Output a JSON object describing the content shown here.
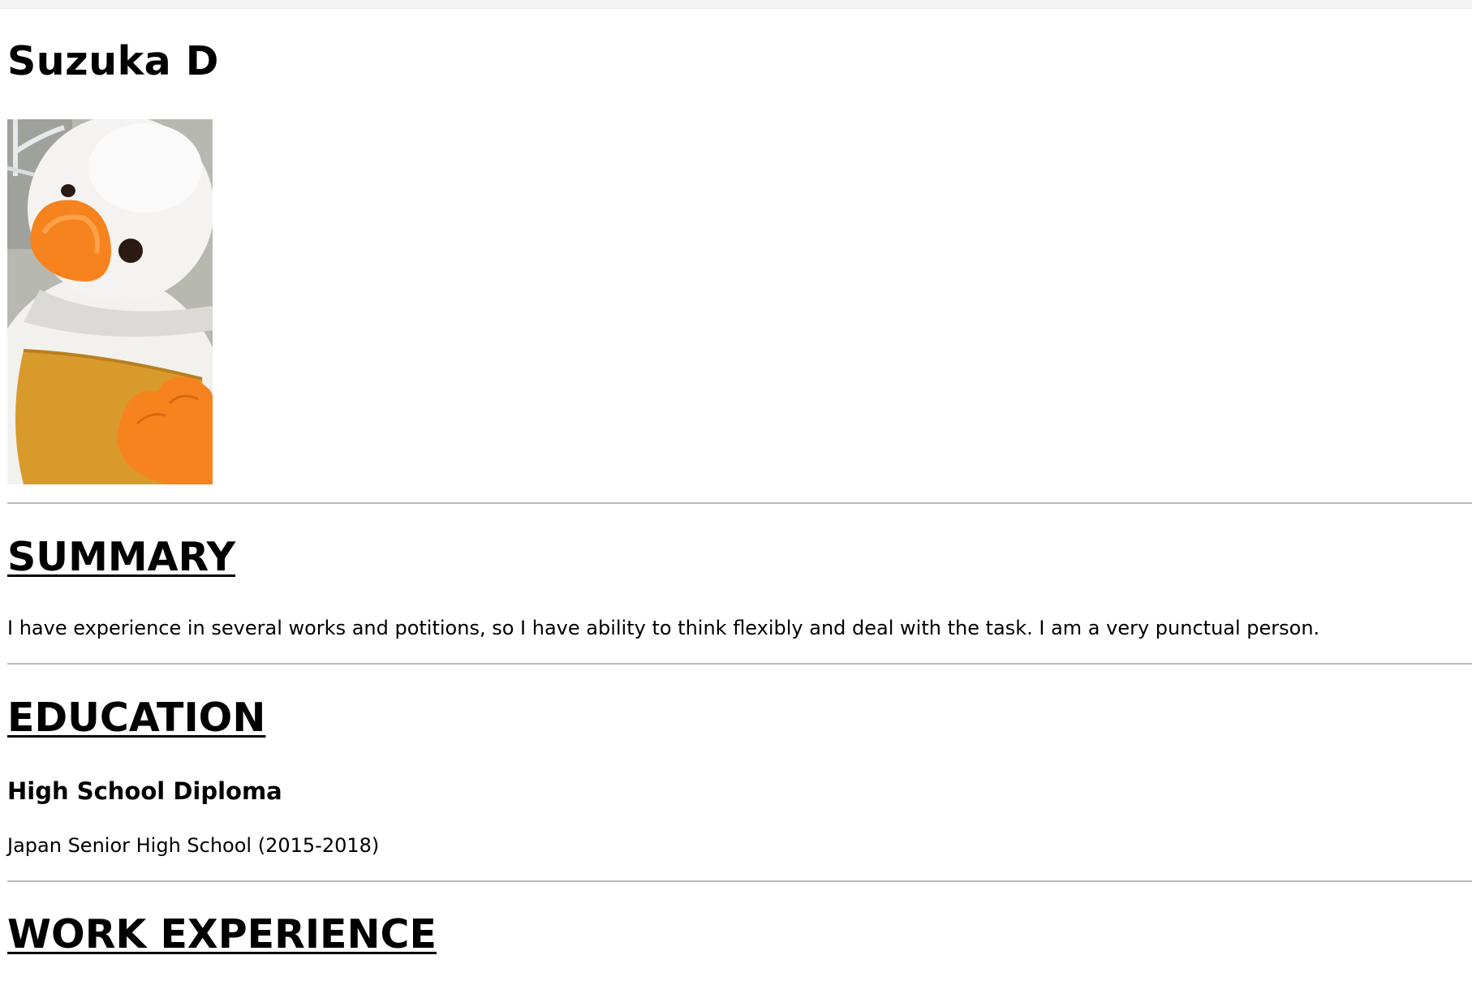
{
  "profile": {
    "name": "Suzuka D",
    "photo_icon": "plush-duck-photo"
  },
  "summary": {
    "heading": "SUMMARY",
    "text": "I have experience in several works and potitions, so I have ability to think flexibly and deal with the task. I am a very punctual person."
  },
  "education": {
    "heading": "EDUCATION",
    "degree": "High School Diploma",
    "school": "Japan Senior High School (2015-2018)"
  },
  "work": {
    "heading": "WORK EXPERIENCE"
  },
  "colors": {
    "text": "#000000",
    "rule": "#b8b8b8",
    "background": "#ffffff"
  }
}
